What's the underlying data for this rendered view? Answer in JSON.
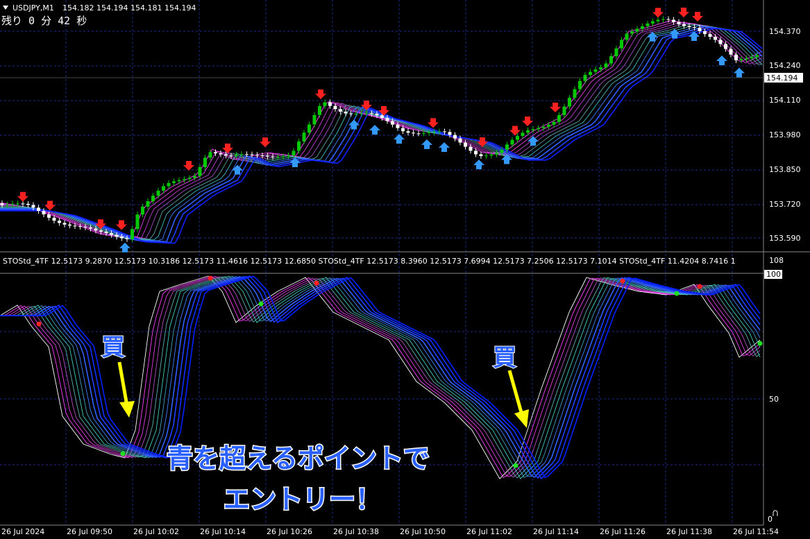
{
  "main_pane": {
    "symbol_label": "USDJPY,M1",
    "ohlc": "154.182 154.194 154.181 154.194",
    "timer": "残り 0 分 42 秒",
    "price_ticks": [
      "154.370",
      "154.240",
      "154.110",
      "153.980",
      "153.850",
      "153.720",
      "153.590"
    ],
    "current_price": "154.194"
  },
  "sub_pane": {
    "indicator_label": "STOStd_4TF 12.5173 9.2870 12.5173 10.3186 12.5173 11.4616 12.5173 12.6850   STOStd_4TF 12.5173 8.3960 12.5173 7.6994 12.5173 7.2506 12.5173 7.1014   STOStd_4TF 11.4204 8.7416 1",
    "scale_top": "108",
    "level_100": "100",
    "level_50": "50",
    "level_0": "0"
  },
  "time_axis": [
    "26 Jul 2024",
    "26 Jul 09:50",
    "26 Jul 10:02",
    "26 Jul 10:14",
    "26 Jul 10:26",
    "26 Jul 10:38",
    "26 Jul 10:50",
    "26 Jul 11:02",
    "26 Jul 11:14",
    "26 Jul 11:26",
    "26 Jul 11:38",
    "26 Jul 11:54"
  ],
  "annotations": {
    "buy_label_1": "買",
    "buy_label_2": "買",
    "caption_line1": "青を超えるポイントで",
    "caption_line2": "エントリー！"
  },
  "colors": {
    "background": "#000000",
    "grid": "#1e2a8a",
    "axis_text": "#ffffff",
    "bull_candle": "#00c800",
    "bear_candle": "#ffffff",
    "up_arrow": "#3399ff",
    "down_arrow": "#ff2020",
    "callout_arrow": "#ffff00",
    "callout_text": "#2a60ff"
  }
}
